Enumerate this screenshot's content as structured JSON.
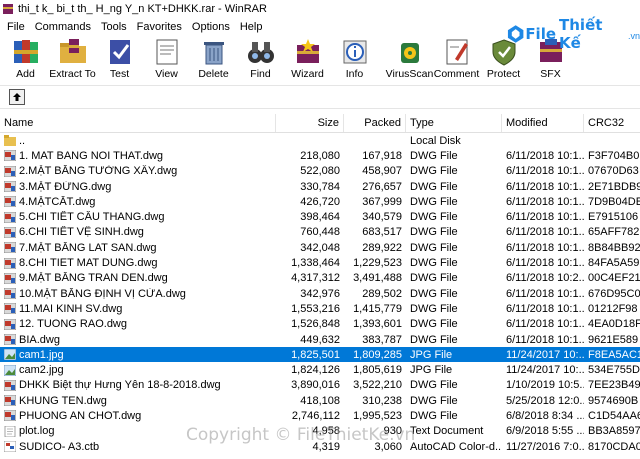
{
  "window": {
    "title": "thi_t k_ bi_t th_ H_ng Y_n KT+DHKK.rar - WinRAR"
  },
  "menu": [
    "File",
    "Commands",
    "Tools",
    "Favorites",
    "Options",
    "Help"
  ],
  "toolbar": [
    {
      "label": "Add",
      "icon": "books-add-icon"
    },
    {
      "label": "Extract To",
      "icon": "folder-extract-icon"
    },
    {
      "label": "Test",
      "icon": "test-checkmark-icon"
    },
    {
      "label": "View",
      "icon": "view-document-icon"
    },
    {
      "label": "Delete",
      "icon": "delete-bin-icon"
    },
    {
      "label": "Find",
      "icon": "binoculars-icon"
    },
    {
      "label": "Wizard",
      "icon": "wizard-icon"
    },
    {
      "label": "Info",
      "icon": "info-icon"
    },
    {
      "label": "VirusScan",
      "icon": "virusscan-icon"
    },
    {
      "label": "Comment",
      "icon": "comment-icon"
    },
    {
      "label": "Protect",
      "icon": "shield-icon"
    },
    {
      "label": "SFX",
      "icon": "sfx-icon"
    }
  ],
  "watermark": {
    "brand": "File",
    "brand2": "Thiết Kế",
    "suffix": ".vn",
    "copyright": "Copyright © FileThietKe.vn"
  },
  "columns": {
    "name": "Name",
    "size": "Size",
    "packed": "Packed",
    "type": "Type",
    "modified": "Modified",
    "crc": "CRC32"
  },
  "files": [
    {
      "name": "..",
      "size": "",
      "packed": "",
      "type": "Local Disk",
      "modified": "",
      "crc": "",
      "icon": "folder"
    },
    {
      "name": "1. MAT BANG NOI THAT.dwg",
      "size": "218,080",
      "packed": "167,918",
      "type": "DWG File",
      "modified": "6/11/2018 10:1...",
      "crc": "F3F704B0",
      "icon": "dwg"
    },
    {
      "name": "2.MẶT BẰNG TƯỜNG XÂY.dwg",
      "size": "522,080",
      "packed": "458,907",
      "type": "DWG File",
      "modified": "6/11/2018 10:1...",
      "crc": "07670D63",
      "icon": "dwg"
    },
    {
      "name": "3.MẶT ĐỨNG.dwg",
      "size": "330,784",
      "packed": "276,657",
      "type": "DWG File",
      "modified": "6/11/2018 10:1...",
      "crc": "2E71BDB9",
      "icon": "dwg"
    },
    {
      "name": "4.MẶTCẮT.dwg",
      "size": "426,720",
      "packed": "367,999",
      "type": "DWG File",
      "modified": "6/11/2018 10:1...",
      "crc": "7D9B04DE",
      "icon": "dwg"
    },
    {
      "name": "5.CHI TIẾT CẦU THANG.dwg",
      "size": "398,464",
      "packed": "340,579",
      "type": "DWG File",
      "modified": "6/11/2018 10:1...",
      "crc": "E7915106",
      "icon": "dwg"
    },
    {
      "name": "6.CHI TIẾT VỆ SINH.dwg",
      "size": "760,448",
      "packed": "683,517",
      "type": "DWG File",
      "modified": "6/11/2018 10:1...",
      "crc": "65AFF782",
      "icon": "dwg"
    },
    {
      "name": "7.MẶT BẰNG LAT SAN.dwg",
      "size": "342,048",
      "packed": "289,922",
      "type": "DWG File",
      "modified": "6/11/2018 10:1...",
      "crc": "8B84BB92",
      "icon": "dwg"
    },
    {
      "name": "8.CHI TIET MAT DUNG.dwg",
      "size": "1,338,464",
      "packed": "1,229,523",
      "type": "DWG File",
      "modified": "6/11/2018 10:1...",
      "crc": "84FA5A59",
      "icon": "dwg"
    },
    {
      "name": "9.MẶT BẰNG TRAN DEN.dwg",
      "size": "4,317,312",
      "packed": "3,491,488",
      "type": "DWG File",
      "modified": "6/11/2018 10:2...",
      "crc": "00C4EF21",
      "icon": "dwg"
    },
    {
      "name": "10.MẶT BẰNG ĐỊNH VỊ CỬA.dwg",
      "size": "342,976",
      "packed": "289,502",
      "type": "DWG File",
      "modified": "6/11/2018 10:1...",
      "crc": "676D95C0",
      "icon": "dwg"
    },
    {
      "name": "11.MAI KINH SV.dwg",
      "size": "1,553,216",
      "packed": "1,415,779",
      "type": "DWG File",
      "modified": "6/11/2018 10:1...",
      "crc": "01212F98",
      "icon": "dwg"
    },
    {
      "name": "12. TUONG RAO.dwg",
      "size": "1,526,848",
      "packed": "1,393,601",
      "type": "DWG File",
      "modified": "6/11/2018 10:1...",
      "crc": "4EA0D18F",
      "icon": "dwg"
    },
    {
      "name": "BIA.dwg",
      "size": "449,632",
      "packed": "383,787",
      "type": "DWG File",
      "modified": "6/11/2018 10:1...",
      "crc": "9621E589",
      "icon": "dwg"
    },
    {
      "name": "cam1.jpg",
      "size": "1,825,501",
      "packed": "1,809,285",
      "type": "JPG File",
      "modified": "11/24/2017 10:...",
      "crc": "F8EA5AC1",
      "icon": "jpg",
      "selected": true
    },
    {
      "name": "cam2.jpg",
      "size": "1,824,126",
      "packed": "1,805,619",
      "type": "JPG File",
      "modified": "11/24/2017 10:...",
      "crc": "534E755D",
      "icon": "jpg"
    },
    {
      "name": "DHKK Biệt thự Hưng Yên 18-8-2018.dwg",
      "size": "3,890,016",
      "packed": "3,522,210",
      "type": "DWG File",
      "modified": "1/10/2019 10:5...",
      "crc": "7EE23B49",
      "icon": "dwg"
    },
    {
      "name": "KHUNG TEN.dwg",
      "size": "418,108",
      "packed": "310,238",
      "type": "DWG File",
      "modified": "5/25/2018 12:0...",
      "crc": "9574690B",
      "icon": "dwg"
    },
    {
      "name": "PHUONG AN CHOT.dwg",
      "size": "2,746,112",
      "packed": "1,995,523",
      "type": "DWG File",
      "modified": "6/8/2018 8:34 ...",
      "crc": "C1D54AA6",
      "icon": "dwg"
    },
    {
      "name": "plot.log",
      "size": "4,958",
      "packed": "930",
      "type": "Text Document",
      "modified": "6/9/2018 5:55 ...",
      "crc": "BB3A8597",
      "icon": "txt"
    },
    {
      "name": "SUDICO- A3.ctb",
      "size": "4,319",
      "packed": "3,060",
      "type": "AutoCAD Color-d...",
      "modified": "11/27/2016 7:0...",
      "crc": "8170CDA0",
      "icon": "ctb"
    }
  ]
}
